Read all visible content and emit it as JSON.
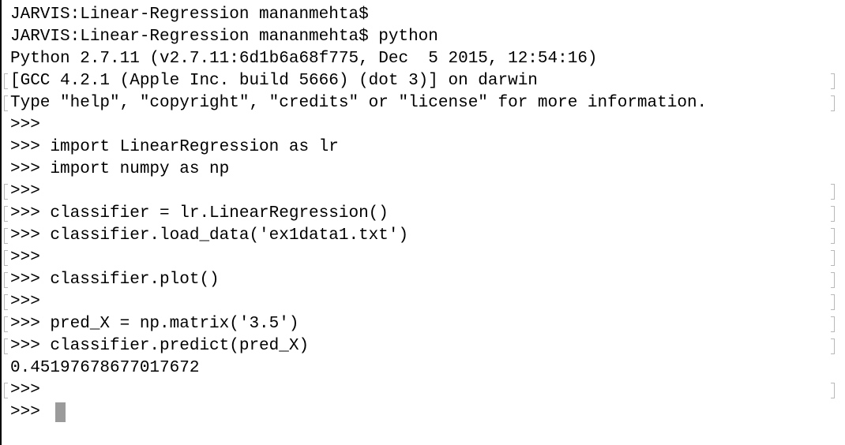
{
  "terminal": {
    "lines": [
      "JARVIS:Linear-Regression mananmehta$",
      "JARVIS:Linear-Regression mananmehta$ python",
      "Python 2.7.11 (v2.7.11:6d1b6a68f775, Dec  5 2015, 12:54:16)",
      "[GCC 4.2.1 (Apple Inc. build 5666) (dot 3)] on darwin",
      "Type \"help\", \"copyright\", \"credits\" or \"license\" for more information.",
      ">>>",
      ">>> import LinearRegression as lr",
      ">>> import numpy as np",
      ">>>",
      ">>> classifier = lr.LinearRegression()",
      ">>> classifier.load_data('ex1data1.txt')",
      ">>>",
      ">>> classifier.plot()",
      ">>>",
      ">>> pred_X = np.matrix('3.5')",
      ">>> classifier.predict(pred_X)",
      "0.45197678677017672",
      ">>>",
      ">>> "
    ],
    "marked_lines": [
      3,
      4,
      8,
      9,
      10,
      11,
      12,
      13,
      14,
      15,
      17
    ],
    "cursor_color": "#9b9b9b",
    "text_color": "#000000",
    "background_color": "#ffffff"
  }
}
